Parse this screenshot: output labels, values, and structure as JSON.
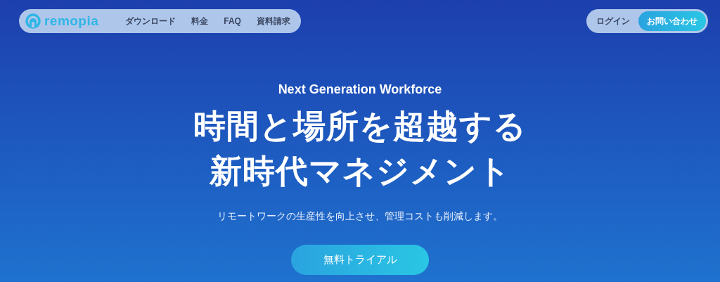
{
  "header": {
    "logo": "remopia",
    "nav": [
      "ダウンロード",
      "料金",
      "FAQ",
      "資料請求"
    ],
    "login": "ログイン",
    "contact": "お問い合わせ"
  },
  "hero": {
    "eyebrow": "Next Generation Workforce",
    "headline": [
      "時間と場所を超越する",
      "新時代マネジメント"
    ],
    "subtitle": "リモートワークの生産性を向上させ、管理コストも削減します。",
    "cta": "無料トライアル"
  }
}
